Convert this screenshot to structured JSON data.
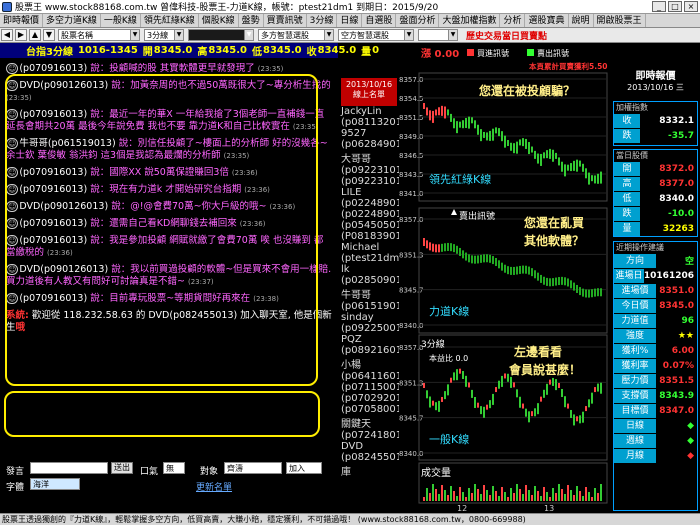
{
  "window": {
    "title": "股票王 www.stock88168.com.tw 曾偉科技-股票王-力道K線，帳號：ptest21dm1 到期日：2015/9/20"
  },
  "menu": [
    "即時報價",
    "多空力道K線",
    "一般K線",
    "領先紅綠K線",
    "個股K線",
    "盤勢",
    "買賣訊號",
    "3分線",
    "日線",
    "自選股",
    "盤面分析",
    "大盤加權指數",
    "分析",
    "選股寶典",
    "說明",
    "開啟股票王"
  ],
  "toolbar": {
    "stock_select": "股票名稱",
    "interval_select": "3分線",
    "strategy1": "多方智慧選股",
    "strategy2": "空方智慧選股",
    "warning": "歷史交易當日買賣點"
  },
  "quote": {
    "session": "台指3分線",
    "time_range": "1016-1345",
    "open_label": "開",
    "open": "8345.0",
    "high_label": "高",
    "high": "8345.0",
    "low_label": "低",
    "low": "8345.0",
    "close_label": "收",
    "close": "8345.0",
    "vol_label": "量",
    "vol": "0"
  },
  "chat": [
    {
      "nick": "(p070916013)",
      "text": "說：投顧喊的股 其實軟體更早就發現了",
      "time": "(23:35)"
    },
    {
      "nick": "DVD(p090126013)",
      "text": "說：加黃奈周的也不過50萬既很大了~專分析生找的",
      "time": "(23:35)"
    },
    {
      "nick": "(p070916013)",
      "text": "說：最近一年的華X 一年給我搶了3個老師一直補錢一直延長會期共20萬 最後今年說免費 我也不要 靠力道K和自己比較實在",
      "time": "(23:35)"
    },
    {
      "nick": "牛哥哥(p061519013)",
      "text": "說：別信任投顧了~樓面上的分析師 好的沒幾各~ 余士欽 葉俊敏 翁洪鈞 這3個是我認為最爛的分析師",
      "time": "(23:35)"
    },
    {
      "nick": "(p070916013)",
      "text": "說：國際XX 說50萬保證賺回3倍",
      "time": "(23:36)"
    },
    {
      "nick": "(p070916013)",
      "text": "說：現在有力道k 才開始研究台指期",
      "time": "(23:36)"
    },
    {
      "nick": "DVD(p090126013)",
      "text": "說：@!@會費70萬~你大戶級的哦~",
      "time": "(23:36)"
    },
    {
      "nick": "(p070916013)",
      "text": "說：還需自己看KD網聊錢去補回來",
      "time": "(23:36)"
    },
    {
      "nick": "(p070916013)",
      "text": "說：我是參加投顧 網賦就繳了會費70萬 唉 也沒賺到 都當繳稅的",
      "time": "(23:36)"
    },
    {
      "nick": "DVD(p090126013)",
      "text": "說：我以前買過投顧的軟體~但是買來不會用一樣賠.買力道後有人教又有問好可討論真是不錯~",
      "time": "(23:37)"
    },
    {
      "nick": "(p070916013)",
      "text": "說：目前專玩股票~等期貨間好再來在",
      "time": "(23:38)"
    }
  ],
  "system_msg": {
    "label": "系統:",
    "text": "歡迎從 118.232.58.63 的 DVD(p082455013) 加入聊天室, 他是個新生",
    "tail": "哦"
  },
  "input": {
    "speak_label": "發言",
    "send": "送出",
    "mouth_label": "口氣",
    "mouth_value": "無",
    "target_label": "對象",
    "target_value": "齊濤",
    "add_select": "加入",
    "font_label": "字體",
    "font_value": "海洋",
    "refresh": "更新名單"
  },
  "users": {
    "date": "2013/10/16",
    "head": "線上名單",
    "list": [
      "JackyLin",
      "(p08113201",
      "9527",
      "(p06284901",
      "大哥哥",
      "(p09223101",
      "(p09223101",
      "LILE",
      "(p02248901",
      "(p02248901",
      "(p05450501",
      "(P08183901",
      "Michael",
      "(ptest21dm1",
      "lk",
      "(p02850901",
      "牛哥哥",
      "(p06151901",
      "sinday",
      "(p09225001",
      "PQZ",
      "(p08921601",
      "小楊",
      "(p06411601",
      "(p07115001",
      "(p07029201",
      "(p07058001",
      "關鍵天",
      "(p07241801",
      "DVD",
      "(p08245501",
      "庫"
    ]
  },
  "chart": {
    "indicator": "漲 0.00",
    "legend_buy": "買進訊號",
    "legend_sell": "賣出訊號",
    "hist_label": "本頁累計買賣獲利",
    "hist_value": "5.50",
    "q1": "您還在被投顧騙？",
    "line1": "領先紅綠K線",
    "sell_signal": "賣出訊號",
    "q2a": "您還在亂買",
    "q2b": "其他軟體？",
    "line2": "力道K線",
    "three_min": "3分線",
    "cost_line": "本益比 0.0",
    "q3a": "左邊看看",
    "q3b": "會員說甚麼！",
    "line3": "一般K線",
    "volume": "成交量",
    "ticks_top": [
      "8357.0",
      "8354.5",
      "8351.5",
      "8349.0",
      "8346.5",
      "8343.5",
      "8341.0"
    ],
    "ticks_mid": [
      "8357.0",
      "8351.3",
      "8345.7",
      "8340.0"
    ],
    "ticks_bot": [
      "8357.0",
      "8351.3",
      "8345.7",
      "8340.0"
    ],
    "x_ticks": [
      "12",
      "13"
    ]
  },
  "right": {
    "title": "即時報價",
    "date": "2013/10/16",
    "weekday": "三",
    "weighted_label": "加權指數",
    "close_label": "收",
    "close": "8332.1",
    "chg_label": "跌",
    "chg": "-35.7",
    "day_label": "當日股價",
    "open_label": "開",
    "open": "8372.0",
    "high_label": "高",
    "high": "8377.0",
    "low_label": "低",
    "low": "8340.0",
    "chg2_label": "跌",
    "chg2": "-10.0",
    "vol_label": "量",
    "vol": "32263",
    "recent_label": "近期操作建議",
    "rows": [
      {
        "k": "方向",
        "v": "空",
        "c": "green"
      },
      {
        "k": "進場日",
        "v": "10161206",
        "c": "white"
      },
      {
        "k": "進場價",
        "v": "8351.0",
        "c": "red"
      },
      {
        "k": "今日價",
        "v": "8345.0",
        "c": "red"
      },
      {
        "k": "力道值",
        "v": "96",
        "c": "green"
      },
      {
        "k": "強度",
        "v": "★★",
        "c": "yellow"
      },
      {
        "k": "獲利%",
        "v": "6.00",
        "c": "red"
      },
      {
        "k": "獲利率",
        "v": "0.07%",
        "c": "red"
      },
      {
        "k": "壓力價",
        "v": "8351.5",
        "c": "red"
      },
      {
        "k": "支撐價",
        "v": "8343.9",
        "c": "green"
      },
      {
        "k": "目標價",
        "v": "8347.0",
        "c": "red"
      },
      {
        "k": "日線",
        "v": "◆",
        "c": "green"
      },
      {
        "k": "週線",
        "v": "◆",
        "c": "green"
      },
      {
        "k": "月線",
        "v": "◆",
        "c": "red"
      }
    ]
  },
  "status": "股票王透過獨創的『力道K線』，輕鬆掌握多空方向，低買高賣，大賺小賠，穩定獲利，不可錯過哦！ (www.stock88168.com.tw，0800-669988)"
}
